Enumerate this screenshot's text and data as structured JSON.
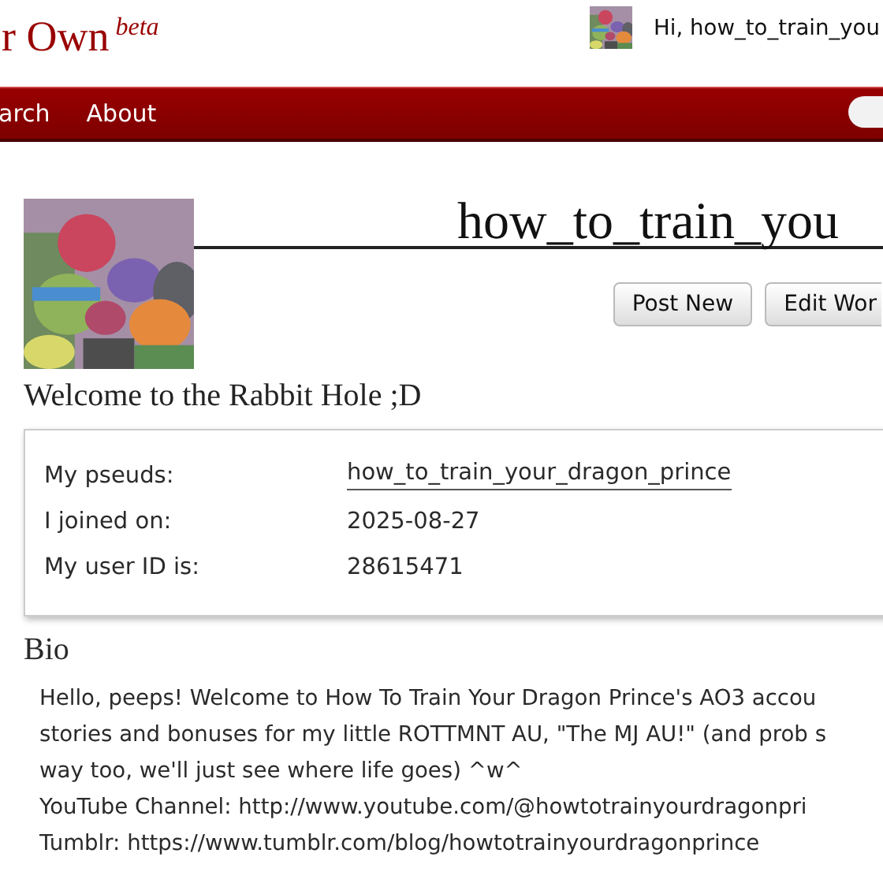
{
  "header": {
    "logo": "r Own",
    "logo_badge": "beta",
    "greeting": "Hi, how_to_train_you"
  },
  "nav": {
    "items": [
      "arch",
      "About"
    ]
  },
  "profile": {
    "title": "how_to_train_you",
    "buttons": [
      "Post New",
      "Edit Wor"
    ],
    "heading": "Welcome to the Rabbit Hole ;D",
    "details": [
      {
        "label": "My pseuds:",
        "value": "how_to_train_your_dragon_prince",
        "kind": "link"
      },
      {
        "label": "I joined on:",
        "value": "2025-08-27",
        "kind": "text"
      },
      {
        "label": "My user ID is:",
        "value": "28615471",
        "kind": "text"
      }
    ]
  },
  "bio": {
    "heading": "Bio",
    "lines": [
      "Hello, peeps! Welcome to How To Train Your Dragon Prince's AO3 accou",
      "stories and bonuses for my little ROTTMNT AU, \"The MJ AU!\" (and prob s",
      "way too, we'll just see where life goes) ^w^",
      "YouTube Channel: http://www.youtube.com/@howtotrainyourdragonpri",
      "Tumblr: https://www.tumblr.com/blog/howtotrainyourdragonprince"
    ]
  }
}
